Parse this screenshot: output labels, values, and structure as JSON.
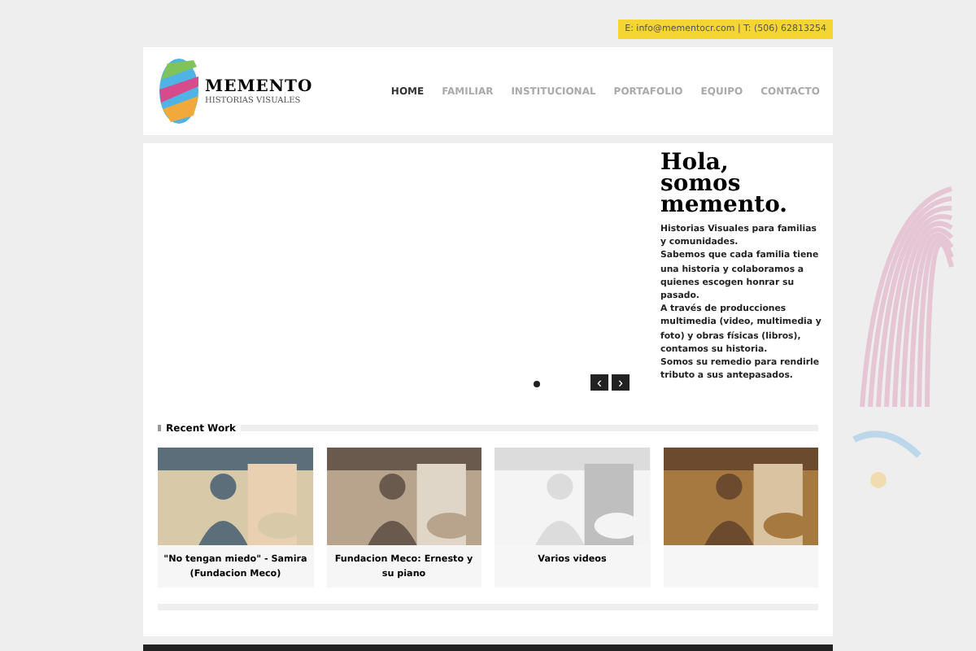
{
  "contact": {
    "text": "E: info@mementocr.com | T: (506) 62813254"
  },
  "logo": {
    "name": "MEMENTO",
    "tagline": "HISTORIAS VISUALES"
  },
  "nav": [
    {
      "label": "HOME",
      "selected": true
    },
    {
      "label": "FAMILIAR",
      "selected": false
    },
    {
      "label": "INSTITUCIONAL",
      "selected": false
    },
    {
      "label": "PORTAFOLIO",
      "selected": false
    },
    {
      "label": "EQUIPO",
      "selected": false
    },
    {
      "label": "CONTACTO",
      "selected": false
    }
  ],
  "slider": {
    "heading": [
      "Hola,",
      "somos",
      "memento."
    ],
    "body": [
      "Historias Visuales para familias y comunidades.",
      "Sabemos que cada familia tiene una historia y colaboramos a quienes escogen honrar su pasado.",
      "A través de producciones multimedia (video, multimedia y foto) y obras físicas (libros), contamos su historia.",
      "Somos su remedio para rendirle tributo a sus antepasados."
    ],
    "dots": [
      {
        "selected": true
      }
    ],
    "prev": "‹",
    "next": "›"
  },
  "recent_work": {
    "title": "Recent Work",
    "items": [
      {
        "kind": "picture",
        "caption": "\"No tengan miedo\" - Samira (Fundacion Meco)"
      },
      {
        "kind": "picture",
        "caption": "Fundacion Meco: Ernesto y su piano"
      },
      {
        "kind": "picture",
        "caption": "Varios videos"
      },
      {
        "kind": "picture"
      }
    ]
  }
}
